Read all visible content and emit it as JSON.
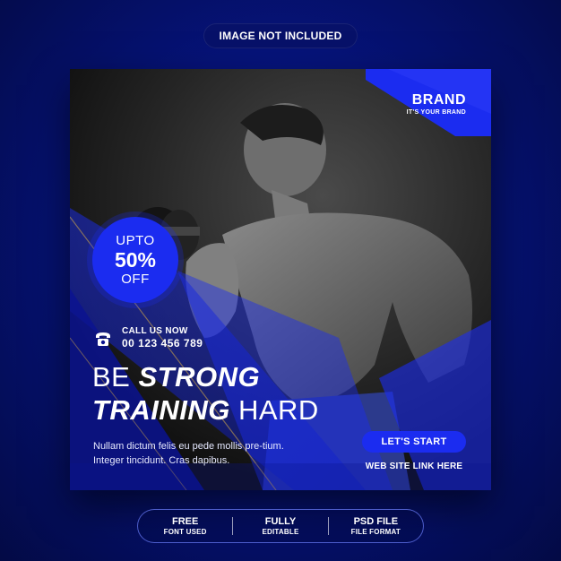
{
  "top_label": "IMAGE NOT INCLUDED",
  "brand": {
    "name": "BRAND",
    "tagline": "IT'S YOUR BRAND"
  },
  "offer": {
    "line1": "UPTO",
    "line2": "50%",
    "line3": "OFF"
  },
  "contact": {
    "label": "CALL US NOW",
    "number": "00 123 456 789"
  },
  "headline": {
    "line1_light": "BE ",
    "line1_bold": "STRONG",
    "line2_bold": "TRAINING",
    "line2_light": " HARD"
  },
  "description": "Nullam dictum felis eu pede mollis pre-tium. Integer tincidunt. Cras dapibus.",
  "cta_label": "LET'S START",
  "website_label": "WEB SITE LINK HERE",
  "features": [
    {
      "title": "FREE",
      "subtitle": "FONT USED"
    },
    {
      "title": "FULLY",
      "subtitle": "EDITABLE"
    },
    {
      "title": "PSD FILE",
      "subtitle": "FILE FORMAT"
    }
  ],
  "colors": {
    "accent": "#1b2cf0",
    "background": "#06137a",
    "photo_tone": "#2a2a2a"
  },
  "icons": {
    "phone": "phone-icon"
  }
}
